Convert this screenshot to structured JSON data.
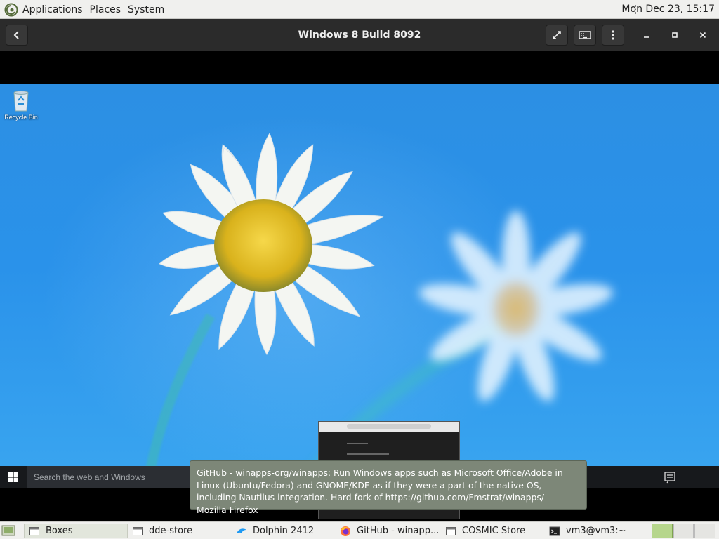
{
  "top_panel": {
    "menus": [
      "Applications",
      "Places",
      "System"
    ],
    "clock": "Mon Dec 23, 15:17"
  },
  "header_bar": {
    "title": "Windows 8 Build 8092",
    "buttons": [
      "back-icon",
      "fullscreen-icon",
      "keyboard-icon",
      "menu-icon",
      "minimize-icon",
      "maximize-icon",
      "close-icon"
    ]
  },
  "win_desktop": {
    "recycle_bin_label": "Recycle Bin",
    "search_placeholder": "Search the web and Windows"
  },
  "tooltip": {
    "text": "GitHub - winapps-org/winapps: Run Windows apps such as Microsoft Office/Adobe in Linux (Ubuntu/Fedora) and GNOME/KDE as if they were a part of the native OS, including Nautilus integration. Hard fork of https://github.com/Fmstrat/winapps/ — Mozilla Firefox"
  },
  "bottom_panel": {
    "tasks": [
      {
        "label": "Boxes",
        "icon": "window-icon",
        "active": true
      },
      {
        "label": "dde-store",
        "icon": "window-icon",
        "active": false
      },
      {
        "label": "Dolphin 2412",
        "icon": "dolphin-icon",
        "active": false
      },
      {
        "label": "GitHub - winapp...",
        "icon": "firefox-icon",
        "active": false
      },
      {
        "label": "COSMIC Store",
        "icon": "window-icon",
        "active": false
      },
      {
        "label": "vm3@vm3:~",
        "icon": "terminal-icon",
        "active": false
      }
    ]
  },
  "colors": {
    "panel_bg": "#f0f0ee",
    "header_bg": "#2b2b2b",
    "tooltip_bg": "#7d8778",
    "desktop_blue": "#2a92ea",
    "workspace_active": "#b6d68c"
  }
}
